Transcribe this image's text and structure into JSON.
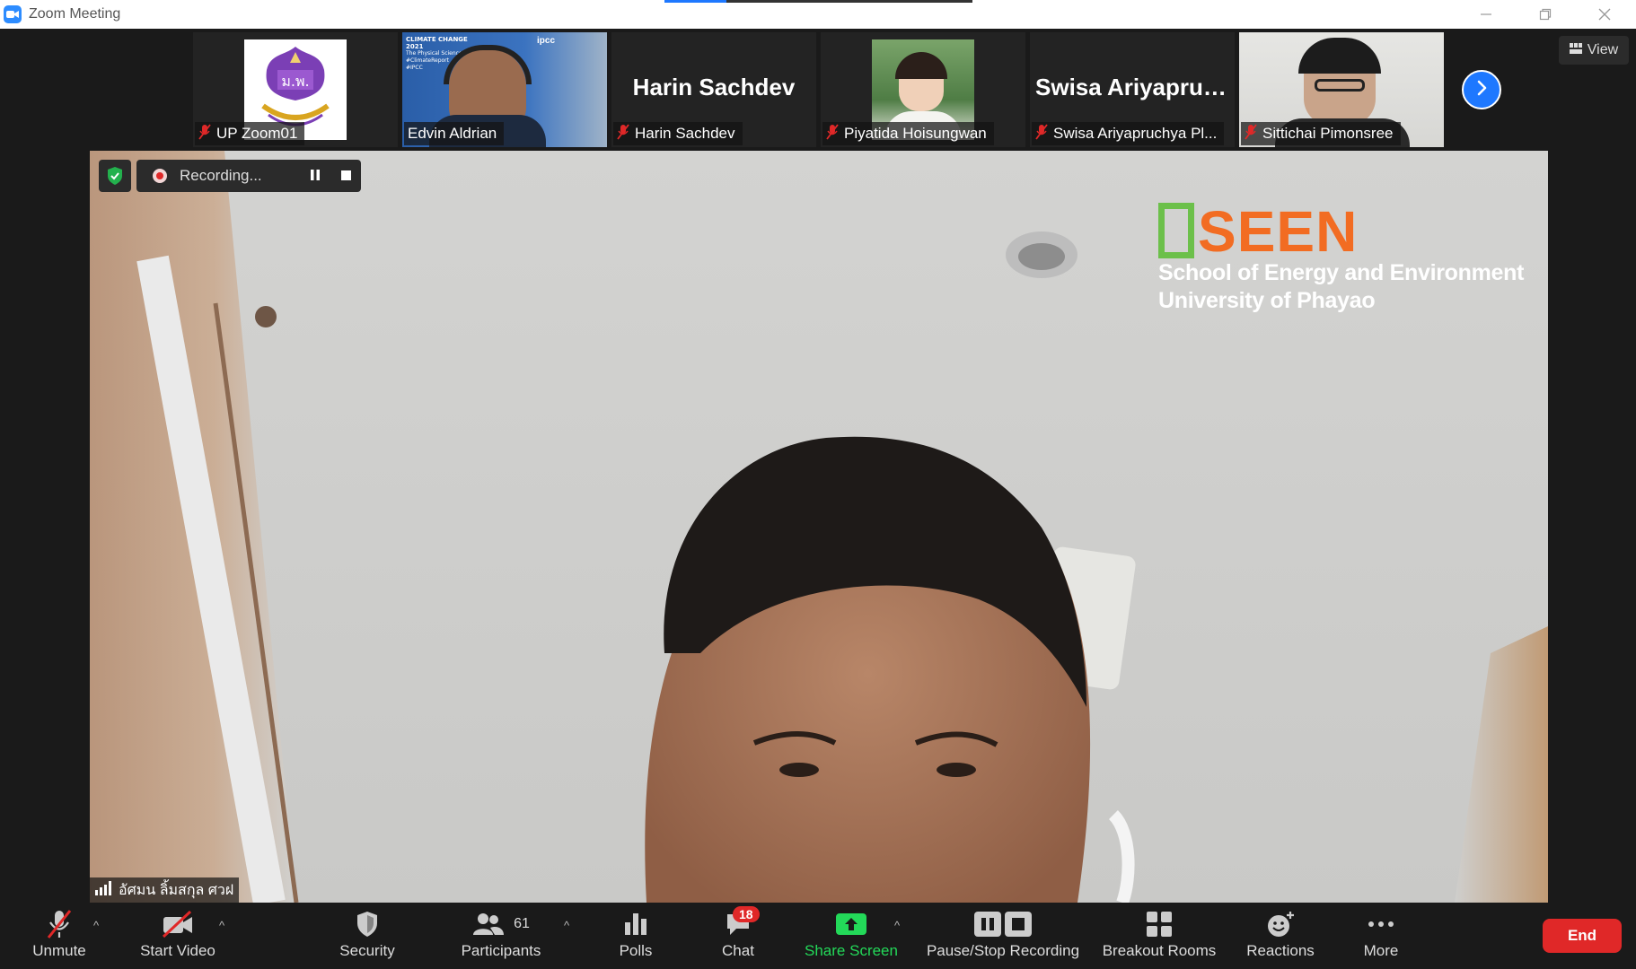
{
  "window": {
    "title": "Zoom Meeting",
    "loading_progress": 0.2
  },
  "strip": {
    "participants": [
      {
        "name": "UP Zoom01",
        "display": "logo",
        "muted": true
      },
      {
        "name": "Edvin Aldrian",
        "display": "video",
        "muted": false
      },
      {
        "name": "Harin Sachdev",
        "big_name": "Harin Sachdev",
        "display": "name",
        "muted": true
      },
      {
        "name": "Piyatida Hoisungwan",
        "display": "video",
        "muted": true
      },
      {
        "name": "Swisa Ariyapruchya Pl...",
        "big_name": "Swisa  Ariyapruc...",
        "display": "name",
        "muted": true
      },
      {
        "name": "Sittichai Pimonsree",
        "display": "video",
        "muted": true
      }
    ],
    "view_label": "View",
    "next_icon": "chevron-right-icon"
  },
  "main": {
    "recording_label": "Recording...",
    "speaker_name": "อัศมน ลิ้มสกุล ศวฝ",
    "logo": {
      "brand": "SEEN",
      "line1": "School of Energy and Environment",
      "line2": "University of Phayao"
    }
  },
  "toolbar": {
    "unmute": "Unmute",
    "start_video": "Start Video",
    "security": "Security",
    "participants": "Participants",
    "participants_count": "61",
    "polls": "Polls",
    "chat": "Chat",
    "chat_badge": "18",
    "share_screen": "Share Screen",
    "recording": "Pause/Stop Recording",
    "breakout": "Breakout Rooms",
    "reactions": "Reactions",
    "more": "More",
    "end": "End"
  },
  "colors": {
    "accent": "#1e78ff",
    "share_green": "#23d959",
    "end_red": "#e02828",
    "muted_red": "#e02828",
    "seen_orange": "#f26c22",
    "seen_green": "#6cc04a"
  }
}
